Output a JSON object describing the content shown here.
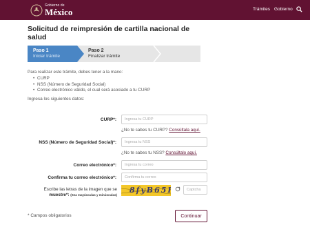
{
  "header": {
    "logo_small": "Gobierno de",
    "logo_big": "México",
    "nav": [
      "Trámites",
      "Gobierno"
    ],
    "search_icon": "search-icon",
    "bg_color": "#611232"
  },
  "title": "Solicitud de reimpresión de cartilla nacional de salud",
  "steps": [
    {
      "number": "Paso 1",
      "desc": "Iniciar trámite",
      "active": true
    },
    {
      "number": "Paso 2",
      "desc": "Finalizar trámite",
      "active": false
    }
  ],
  "intro": "Para realizar este trámite, debes tener a la mano:",
  "requirements": [
    "CURP",
    "NSS (Número de Seguridad Social)",
    "Correo electrónico válido, el cual será asociado a tu CURP"
  ],
  "ingresa": "Ingresa los siguientes datos:",
  "form": {
    "curp": {
      "label": "CURP*:",
      "placeholder": "Ingresa tu CURP"
    },
    "curp_help": {
      "text": "¿No te sabes tu CURP?",
      "link": "Consúltala aquí."
    },
    "nss": {
      "label": "NSS (Número de Seguridad Social)*:",
      "placeholder": "Ingresa tu NSS"
    },
    "nss_help": {
      "text": "¿No te sabes tu NSS?",
      "link": "Consúltalo aquí."
    },
    "correo": {
      "label": "Correo electrónico*:",
      "placeholder": "Ingresa tu correo"
    },
    "confirma": {
      "label": "Confirma tu correo electrónico*:",
      "placeholder": "Confirma tu correo"
    },
    "captcha": {
      "label_line1": "Escribe las letras de la imagen que se",
      "label_line2": "muestre*:",
      "label_small": "(Sea mayúsculas y minúsculas)",
      "image_text": "8fyB65R",
      "placeholder": "Captcha"
    }
  },
  "footer_note": "* Campos obligatorios",
  "continue_label": "Continuar",
  "colors": {
    "accent": "#611232",
    "step_active": "#4a86c5"
  }
}
